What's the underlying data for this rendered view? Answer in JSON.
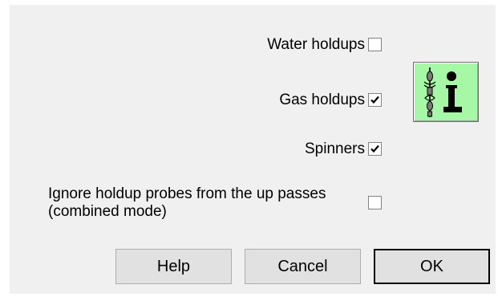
{
  "options": {
    "water_holdups": {
      "label": "Water holdups",
      "checked": false
    },
    "gas_holdups": {
      "label": "Gas holdups",
      "checked": true
    },
    "spinners": {
      "label": "Spinners",
      "checked": true
    },
    "ignore_up_passes": {
      "label": "Ignore holdup probes from the up passes (combined mode)",
      "checked": false
    }
  },
  "icons": {
    "info": "tool-info-icon"
  },
  "buttons": {
    "help": "Help",
    "cancel": "Cancel",
    "ok": "OK"
  },
  "colors": {
    "dialog_bg": "#f0f0f0",
    "info_button_bg": "#a6f7a6",
    "button_bg": "#e1e1e1"
  }
}
